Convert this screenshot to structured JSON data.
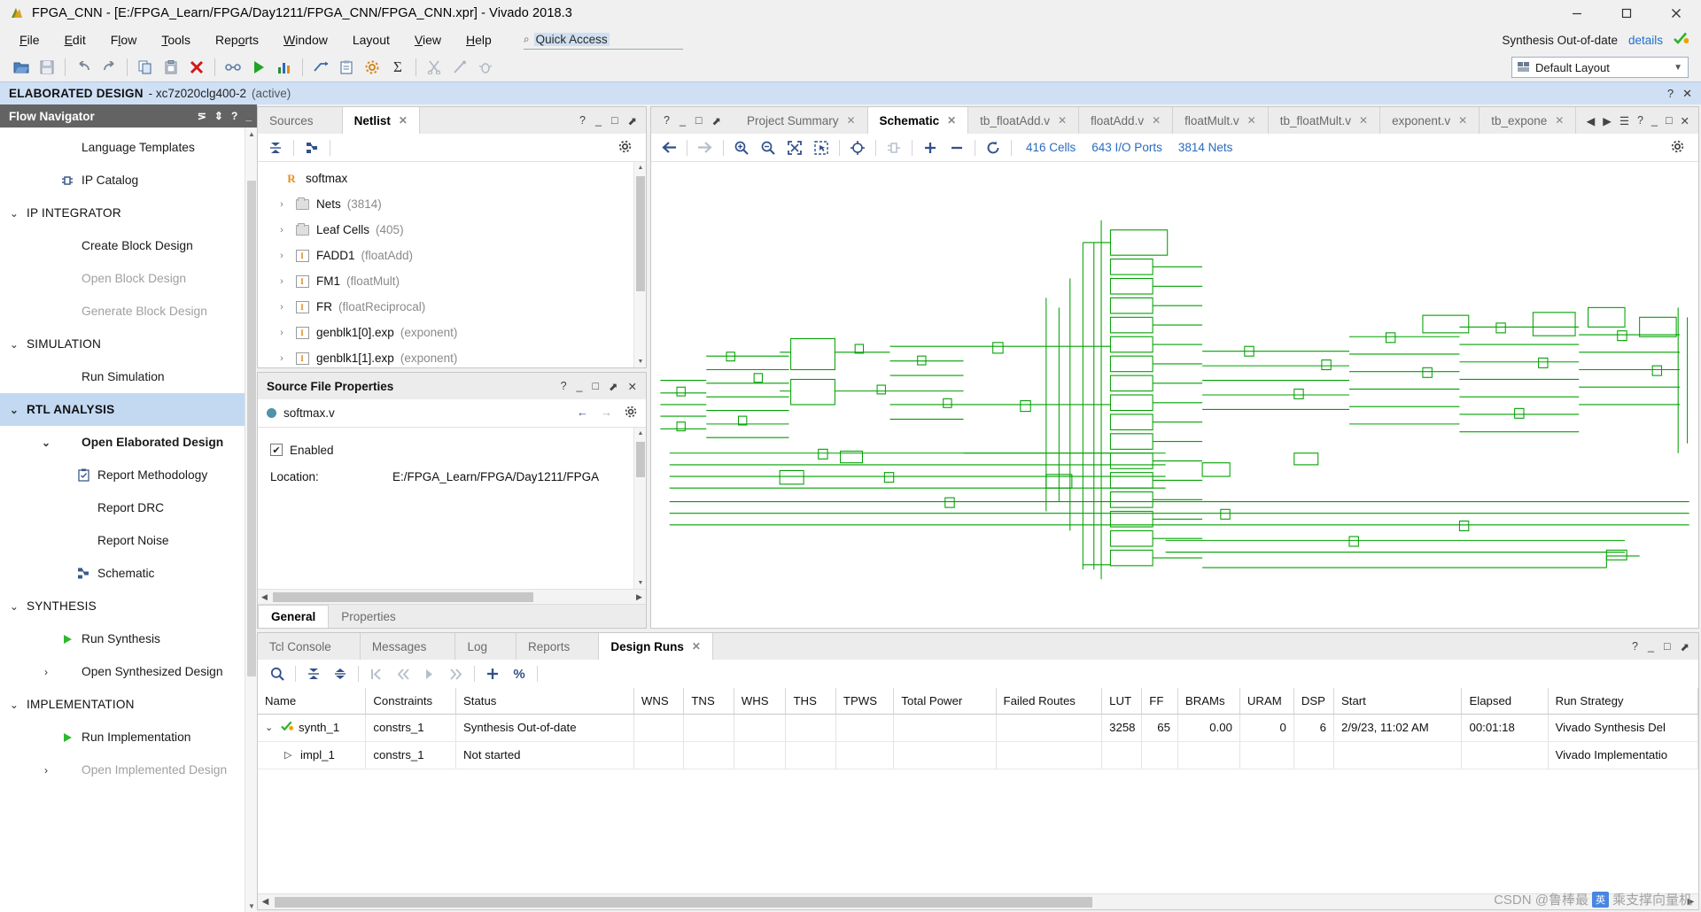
{
  "window": {
    "title": "FPGA_CNN - [E:/FPGA_Learn/FPGA/Day1211/FPGA_CNN/FPGA_CNN.xpr] - Vivado 2018.3",
    "minimize": "–",
    "maximize": "□",
    "close": "✕"
  },
  "menu": {
    "items": [
      "File",
      "Edit",
      "Flow",
      "Tools",
      "Reports",
      "Window",
      "Layout",
      "View",
      "Help"
    ],
    "quick_access_placeholder": "Quick Access",
    "quick_access_value": "Quick Access"
  },
  "status": {
    "label": "Synthesis Out-of-date",
    "details": "details",
    "check_icon": "check-icon"
  },
  "toolbar": {
    "layout_label": "Default Layout",
    "buttons": [
      "open-project-icon",
      "save-icon",
      "undo-icon",
      "redo-icon",
      "copy-icon",
      "paste-icon",
      "cancel-icon",
      "run-link-icon",
      "run-icon",
      "report-icon",
      "implement-icon",
      "clipboard-icon",
      "settings-icon",
      "sigma-icon",
      "cut-icon",
      "wand-icon",
      "bug-icon"
    ]
  },
  "banner": {
    "title": "ELABORATED DESIGN",
    "part": "xc7z020clg400-2",
    "active": "(active)",
    "help": "?",
    "close": "✕"
  },
  "flow_navigator": {
    "header": "Flow Navigator",
    "items": [
      {
        "label": "Language Templates",
        "level": "child",
        "icon": "",
        "style": "normal",
        "chev": ""
      },
      {
        "label": "IP Catalog",
        "level": "child",
        "icon": "ip-catalog-icon",
        "style": "normal",
        "chev": ""
      },
      {
        "label": "IP INTEGRATOR",
        "level": "section",
        "icon": "",
        "style": "section",
        "chev": "v"
      },
      {
        "label": "Create Block Design",
        "level": "child",
        "icon": "",
        "style": "normal",
        "chev": ""
      },
      {
        "label": "Open Block Design",
        "level": "child",
        "icon": "",
        "style": "dim",
        "chev": ""
      },
      {
        "label": "Generate Block Design",
        "level": "child",
        "icon": "",
        "style": "dim",
        "chev": ""
      },
      {
        "label": "SIMULATION",
        "level": "section",
        "icon": "",
        "style": "section",
        "chev": "v"
      },
      {
        "label": "Run Simulation",
        "level": "child",
        "icon": "",
        "style": "normal",
        "chev": ""
      },
      {
        "label": "RTL ANALYSIS",
        "level": "section",
        "icon": "",
        "style": "selected",
        "chev": "v"
      },
      {
        "label": "Open Elaborated Design",
        "level": "child",
        "icon": "",
        "style": "bold",
        "chev": "v"
      },
      {
        "label": "Report Methodology",
        "level": "child2",
        "icon": "report-methodology-icon",
        "style": "normal",
        "chev": ""
      },
      {
        "label": "Report DRC",
        "level": "child2",
        "icon": "",
        "style": "normal",
        "chev": ""
      },
      {
        "label": "Report Noise",
        "level": "child2",
        "icon": "",
        "style": "normal",
        "chev": ""
      },
      {
        "label": "Schematic",
        "level": "child2",
        "icon": "schematic-icon",
        "style": "normal",
        "chev": ""
      },
      {
        "label": "SYNTHESIS",
        "level": "section",
        "icon": "",
        "style": "section",
        "chev": "v"
      },
      {
        "label": "Run Synthesis",
        "level": "child",
        "icon": "play-icon",
        "style": "normal",
        "chev": ""
      },
      {
        "label": "Open Synthesized Design",
        "level": "child",
        "icon": "",
        "style": "normal",
        "chev": ">"
      },
      {
        "label": "IMPLEMENTATION",
        "level": "section",
        "icon": "",
        "style": "section",
        "chev": "v"
      },
      {
        "label": "Run Implementation",
        "level": "child",
        "icon": "play-icon",
        "style": "normal",
        "chev": ""
      },
      {
        "label": "Open Implemented Design",
        "level": "child",
        "icon": "",
        "style": "dim",
        "chev": ">"
      }
    ]
  },
  "netlist_panel": {
    "tabs": [
      {
        "label": "Sources",
        "active": false,
        "closable": false
      },
      {
        "label": "Netlist",
        "active": true,
        "closable": true
      }
    ],
    "root": {
      "label": "softmax",
      "icon": "rtl-module-icon"
    },
    "nodes": [
      {
        "label": "Nets",
        "paren": "(3814)",
        "icon": "folder-icon"
      },
      {
        "label": "Leaf Cells",
        "paren": "(405)",
        "icon": "folder-icon"
      },
      {
        "label": "FADD1",
        "paren": "(floatAdd)",
        "icon": "instance-icon"
      },
      {
        "label": "FM1",
        "paren": "(floatMult)",
        "icon": "instance-icon"
      },
      {
        "label": "FR",
        "paren": "(floatReciprocal)",
        "icon": "instance-icon"
      },
      {
        "label": "genblk1[0].exp",
        "paren": "(exponent)",
        "icon": "instance-icon"
      },
      {
        "label": "genblk1[1].exp",
        "paren": "(exponent)",
        "icon": "instance-icon"
      }
    ]
  },
  "source_file_properties": {
    "title": "Source File Properties",
    "file_name": "softmax.v",
    "enabled_label": "Enabled",
    "enabled_checked": true,
    "location_key": "Location:",
    "location_value": "E:/FPGA_Learn/FPGA/Day1211/FPGA",
    "tabs": [
      {
        "label": "General",
        "active": true
      },
      {
        "label": "Properties",
        "active": false
      }
    ]
  },
  "schematic_panel": {
    "tabs": [
      {
        "label": "Project Summary",
        "active": false
      },
      {
        "label": "Schematic",
        "active": true
      },
      {
        "label": "tb_floatAdd.v",
        "active": false
      },
      {
        "label": "floatAdd.v",
        "active": false
      },
      {
        "label": "floatMult.v",
        "active": false
      },
      {
        "label": "tb_floatMult.v",
        "active": false
      },
      {
        "label": "exponent.v",
        "active": false
      },
      {
        "label": "tb_expone",
        "active": false
      }
    ],
    "counts": [
      "416 Cells",
      "643 I/O Ports",
      "3814 Nets"
    ],
    "toolbar_icons": [
      "back-arrow-icon",
      "forward-arrow-icon",
      "zoom-in-icon",
      "zoom-out-icon",
      "zoom-fit-icon",
      "zoom-area-icon",
      "crosshair-icon",
      "cell-icon",
      "plus-icon",
      "minus-icon",
      "refresh-icon",
      "settings-icon"
    ]
  },
  "design_runs": {
    "tabs": [
      {
        "label": "Tcl Console",
        "active": false,
        "closable": false
      },
      {
        "label": "Messages",
        "active": false,
        "closable": false
      },
      {
        "label": "Log",
        "active": false,
        "closable": false
      },
      {
        "label": "Reports",
        "active": false,
        "closable": false
      },
      {
        "label": "Design Runs",
        "active": true,
        "closable": true
      }
    ],
    "toolbar_icons": [
      "search-icon",
      "collapse-all-icon",
      "expand-all-icon",
      "first-icon",
      "prev-icon",
      "next-icon",
      "last-icon",
      "add-icon",
      "percent-icon"
    ],
    "columns": [
      "Name",
      "Constraints",
      "Status",
      "WNS",
      "TNS",
      "WHS",
      "THS",
      "TPWS",
      "Total Power",
      "Failed Routes",
      "LUT",
      "FF",
      "BRAMs",
      "URAM",
      "DSP",
      "Start",
      "Elapsed",
      "Run Strategy"
    ],
    "rows": [
      {
        "name": "synth_1",
        "indent": 0,
        "chev": "v",
        "icon": "synth-status-icon",
        "constraints": "constrs_1",
        "status": "Synthesis Out-of-date",
        "wns": "",
        "tns": "",
        "whs": "",
        "ths": "",
        "tpws": "",
        "total_power": "",
        "failed_routes": "",
        "lut": "3258",
        "ff": "65",
        "brams": "0.00",
        "uram": "0",
        "dsp": "6",
        "start": "2/9/23, 11:02 AM",
        "elapsed": "00:01:18",
        "run_strategy": "Vivado Synthesis Del"
      },
      {
        "name": "impl_1",
        "indent": 1,
        "chev": ">",
        "icon": "",
        "constraints": "constrs_1",
        "status": "Not started",
        "wns": "",
        "tns": "",
        "whs": "",
        "ths": "",
        "tpws": "",
        "total_power": "",
        "failed_routes": "",
        "lut": "",
        "ff": "",
        "brams": "",
        "uram": "",
        "dsp": "",
        "start": "",
        "elapsed": "",
        "run_strategy": "Vivado Implementatio"
      }
    ]
  },
  "watermark": {
    "text": "CSDN @鲁棒最",
    "badge": "英",
    "suffix": "乘支撑向量机"
  },
  "colors": {
    "accent_blue": "#2a6bbd",
    "banner_blue": "#cfe0f5",
    "selection_blue": "#c3d9f2",
    "schematic_green": "#00a000",
    "status_green": "#27ae22",
    "orange": "#e8901a"
  }
}
